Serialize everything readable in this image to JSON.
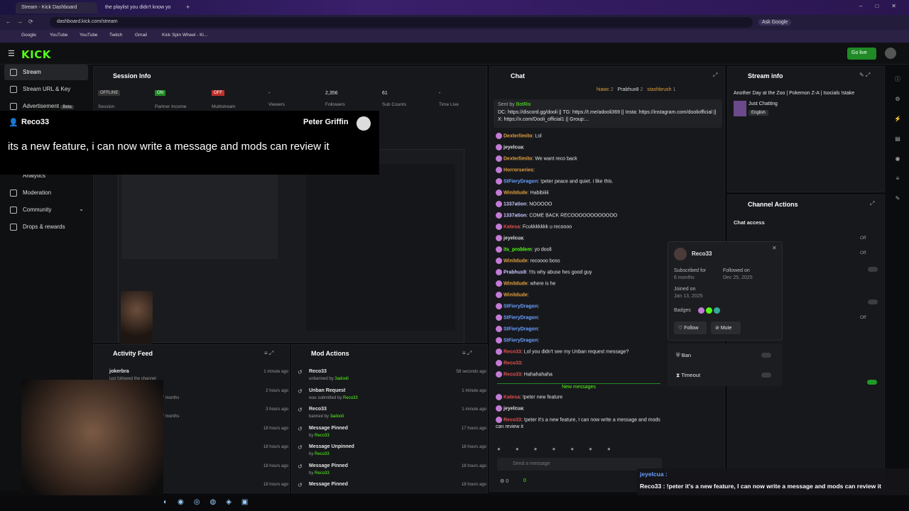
{
  "browser": {
    "tabs": [
      "Stream - Kick Dashboard",
      "the playlist you didn't know yo"
    ],
    "url": "dashboard.kick.com/stream",
    "ask_google": "Ask Google",
    "bookmarks": [
      "Google",
      "YouTube",
      "YouTube",
      "Twitch",
      "Gmail",
      "Kick Spin Wheel - Ki..."
    ]
  },
  "kick": {
    "logo": "KICK",
    "go_live": "Go live"
  },
  "sidebar": {
    "items": [
      "Stream",
      "Stream URL & Key",
      "Advertisement",
      "Analytics",
      "Moderation",
      "Community",
      "Drops & rewards"
    ],
    "beta": "Beta"
  },
  "session": {
    "title": "Session Info",
    "stats": [
      {
        "value": "OFFLINE",
        "label": "Session"
      },
      {
        "value": "ON",
        "label": "Partner Income"
      },
      {
        "value": "OFF",
        "label": "Multistream"
      },
      {
        "value": "-",
        "label": "Viewers"
      },
      {
        "value": "2,356",
        "label": "Followers"
      },
      {
        "value": "61",
        "label": "Sub Counts"
      },
      {
        "value": "-",
        "label": "Time Live"
      }
    ]
  },
  "overlay": {
    "user": "Reco33",
    "streamer": "Peter Griffin",
    "message": "its a new feature, i can now write a message and mods can review it"
  },
  "chat": {
    "title": "Chat",
    "top": [
      {
        "name": "hiawc",
        "n": "2"
      },
      {
        "name": "Prabhux8",
        "n": "2"
      },
      {
        "name": "stashbrush",
        "n": "1"
      }
    ],
    "pinned": {
      "sent_by": "Sent by",
      "bot": "BotRix",
      "text": "DC: https://discord.gg/dooli || TG: https://t.me/adooli369 || Insta: https://instagram.com/dooliofficial || X: https://x.com/Dooli_official1 || Group:..."
    },
    "messages": [
      {
        "u": "Dexterlimito",
        "t": "Lol",
        "c": "#e0a040"
      },
      {
        "u": "jeyelcua",
        "t": "",
        "c": "#dddddd"
      },
      {
        "u": "Dexterlimito",
        "t": "We want reco back",
        "c": "#e0a040"
      },
      {
        "u": "Horrorseries",
        "t": "",
        "c": "#e0a040"
      },
      {
        "u": "StFieryDragon",
        "t": "!peter peace and quiet. i like this.",
        "c": "#6aa0ff"
      },
      {
        "u": "Winitdude",
        "t": "Habibiiiii",
        "c": "#e0a040"
      },
      {
        "u": "1337ation",
        "t": "NOOOOO",
        "c": "#c8c8ff"
      },
      {
        "u": "1337ation",
        "t": "COME BACK RECOOOOOOOOOOOO",
        "c": "#c8c8ff"
      },
      {
        "u": "Katesa",
        "t": "Fcukkkkkkk u recoooo",
        "c": "#e05050"
      },
      {
        "u": "jeyelcua",
        "t": "",
        "c": "#dddddd"
      },
      {
        "u": "its_problem",
        "t": "yo dooli",
        "c": "#53fc18"
      },
      {
        "u": "Winitdude",
        "t": "recoooo boss",
        "c": "#e0a040"
      },
      {
        "u": "Prabhux8",
        "t": "!!ts why abuse hes good guy",
        "c": "#c8c8ff"
      },
      {
        "u": "Winitdude",
        "t": "where is he",
        "c": "#e0a040"
      },
      {
        "u": "Winitdude",
        "t": "",
        "c": "#e0a040"
      },
      {
        "u": "StFieryDragon",
        "t": "",
        "c": "#6aa0ff"
      },
      {
        "u": "StFieryDragon",
        "t": "",
        "c": "#6aa0ff"
      },
      {
        "u": "StFieryDragon",
        "t": "",
        "c": "#6aa0ff"
      },
      {
        "u": "StFieryDragon",
        "t": "",
        "c": "#6aa0ff"
      },
      {
        "u": "Reco33",
        "t": "Lol you didn't see my Unban request message?",
        "c": "#e05050"
      },
      {
        "u": "Reco33",
        "t": "",
        "c": "#e05050"
      },
      {
        "u": "Reco33",
        "t": "Hahahahaha",
        "c": "#e05050"
      }
    ],
    "new_messages": "New messages",
    "after": [
      {
        "u": "Katesa",
        "t": "!peter new feature",
        "c": "#e05050"
      },
      {
        "u": "jeyelcua",
        "t": "",
        "c": "#dddddd"
      },
      {
        "u": "Reco33",
        "t": "!peter it's a new feature, I can now write a message and mods can review it",
        "c": "#e05050"
      }
    ],
    "placeholder": "Send a message",
    "count": "0"
  },
  "stream_info": {
    "title": "Stream info",
    "stream_title": "Another Day at the Zoo | Pokemon Z-A | Isocials !stake",
    "category": "Just Chatting",
    "language": "English"
  },
  "channel_actions": {
    "title": "Channel Actions",
    "chat_access": "Chat access",
    "off1": "Off",
    "off2": "Off",
    "off3": "Off"
  },
  "usercard": {
    "name": "Reco33",
    "sub_label": "Subscribed for",
    "sub_value": "6 months",
    "follow_label": "Followed on",
    "follow_value": "Dec 25, 2025",
    "joined_label": "Joined on",
    "joined_value": "Jan 13, 2025",
    "badges": "Badges",
    "follow_btn": "Follow",
    "mute_btn": "Mute",
    "ban": "Ban",
    "timeout": "Timeout"
  },
  "activity": {
    "title": "Activity Feed",
    "rows": [
      {
        "name": "jokerbra",
        "sub": "just followed the channel",
        "time": "1 minute ago"
      },
      {
        "name": "nvee Resubscribed!",
        "sub": "y have been subscribed for 7 months",
        "time": "2 hours ago"
      },
      {
        "name": "swipe Resubscribed!",
        "sub": "y have been subscribed for 7 months",
        "time": "3 hours ago"
      },
      {
        "name": "",
        "sub": "e channel",
        "time": "18 hours ago"
      },
      {
        "name": "ma",
        "sub": "e channel",
        "time": "18 hours ago"
      },
      {
        "name": "",
        "sub": "e channel",
        "time": "18 hours ago"
      },
      {
        "name": "",
        "sub": "",
        "time": "18 hours ago"
      }
    ]
  },
  "mod_actions": {
    "title": "Mod Actions",
    "rows": [
      {
        "name": "Reco33",
        "sub": "unbanned by",
        "by": "3adooli",
        "time": "58 seconds ago"
      },
      {
        "name": "Unban Request",
        "sub": "was submitted by",
        "by": "Reco33",
        "time": "1 minute ago"
      },
      {
        "name": "Reco33",
        "sub": "banned by",
        "by": "3adooli",
        "time": "1 minute ago"
      },
      {
        "name": "Message Pinned",
        "sub": "by",
        "by": "Reco33",
        "time": "17 hours ago"
      },
      {
        "name": "Message Unpinned",
        "sub": "by",
        "by": "Reco33",
        "time": "18 hours ago"
      },
      {
        "name": "Message Pinned",
        "sub": "by",
        "by": "Reco33",
        "time": "18 hours ago"
      },
      {
        "name": "Message Pinned",
        "sub": "",
        "by": "",
        "time": "18 hours ago"
      }
    ]
  },
  "ticker": {
    "line1_user": "jeyelcua :",
    "line2": "Reco33 : !peter it's a new feature, I can now write a message and mods can review it"
  }
}
